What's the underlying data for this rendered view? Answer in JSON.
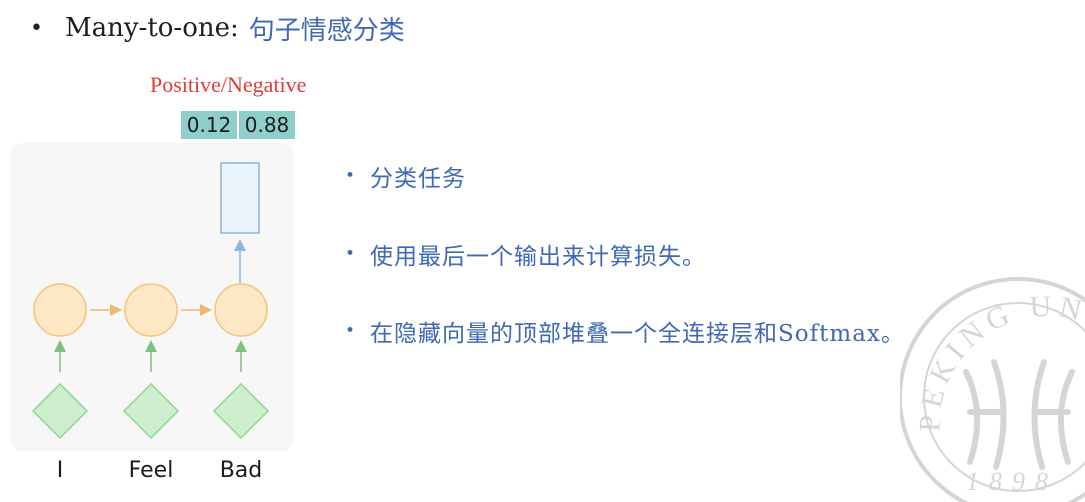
{
  "slide": {
    "bullet_symbol": "•",
    "heading_lead": "Many-to-one:",
    "heading_topic": "句子情感分类"
  },
  "output": {
    "label": "Positive/Negative",
    "probabilities": [
      "0.12",
      "0.88"
    ]
  },
  "inputs": [
    "I",
    "Feel",
    "Bad"
  ],
  "bullets": [
    "分类任务",
    "使用最后一个输出来计算损失。",
    "在隐藏向量的顶部堆叠一个全连接层和Softmax。"
  ],
  "watermark": {
    "arc_text": "PEKING UNIV",
    "year": "1898"
  },
  "colors": {
    "topic_blue": "#3f68b5",
    "label_red": "#e03c3c",
    "prob_teal": "#8ecfcb",
    "hidden_fill": "#fde7c5",
    "hidden_stroke": "#f3c47a",
    "input_fill": "#cdeecd",
    "input_stroke": "#8fd68f",
    "output_fill": "#eaf4fd",
    "output_stroke": "#8fb4dd"
  }
}
